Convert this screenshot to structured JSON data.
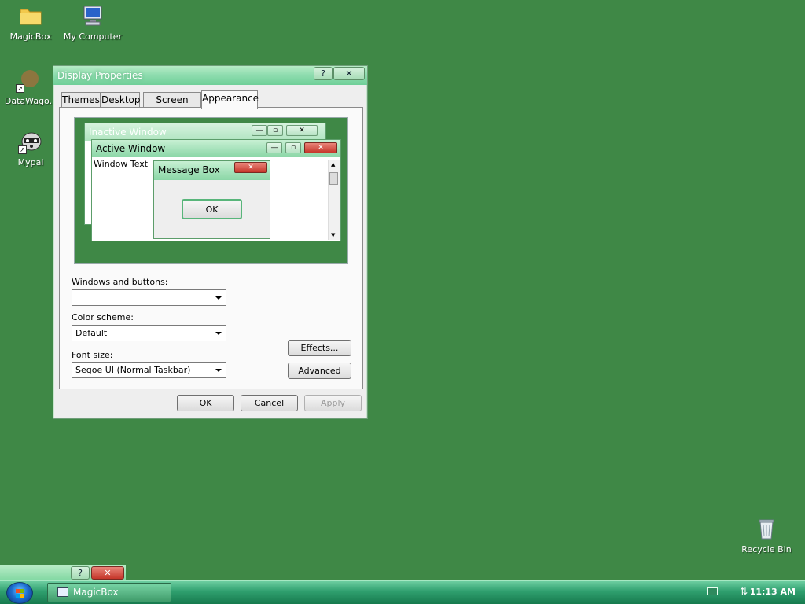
{
  "desktop": {
    "icons": [
      {
        "label": "MagicBox",
        "icon": "folder-icon"
      },
      {
        "label": "My Computer",
        "icon": "computer-icon"
      },
      {
        "label": "DataWago.",
        "icon": "app-shortcut-icon"
      },
      {
        "label": "Mypal",
        "icon": "raccoon-browser-icon"
      },
      {
        "label": "Recycle Bin",
        "icon": "recycle-bin-icon"
      }
    ]
  },
  "dialog": {
    "title": "Display Properties",
    "help_button": "?",
    "close_button": "✕",
    "tabs": [
      "Themes",
      "Desktop",
      "Screen Saver",
      "Appearance"
    ],
    "active_tab": "Appearance",
    "preview": {
      "inactive_window_title": "Inactive Window",
      "active_window_title": "Active Window",
      "window_text": "Window Text",
      "message_box_title": "Message Box",
      "message_box_ok": "OK"
    },
    "windows_and_buttons": {
      "label": "Windows and buttons:",
      "value": ""
    },
    "color_scheme": {
      "label": "Color scheme:",
      "value": "Default"
    },
    "font_size": {
      "label": "Font size:",
      "value": "Segoe UI (Normal Taskbar)"
    },
    "effects_button": "Effects...",
    "advanced_button": "Advanced",
    "ok_button": "OK",
    "cancel_button": "Cancel",
    "apply_button": "Apply"
  },
  "mini_bar": {
    "help": "?",
    "close": "✕"
  },
  "taskbar": {
    "task_label": "MagicBox",
    "clock": "11:13 AM"
  },
  "colors": {
    "desktop_bg": "#3f8846",
    "title_gradient": "#8ad6a6",
    "close_red": "#c5362a"
  }
}
